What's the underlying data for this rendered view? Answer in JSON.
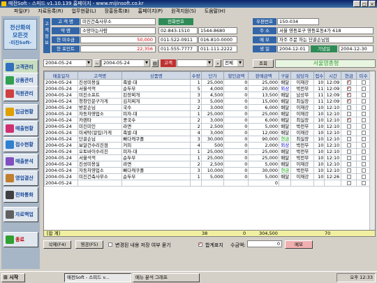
{
  "window": {
    "title": "매전Soft - 스피드 v1.10.139 홈페이지 - www.mijinsoft.co.kr"
  },
  "menu": [
    "파일(F)",
    "자료등록(R)",
    "업무현황(L)",
    "장홍등록(B)",
    "홈페이지(P)",
    "원격지원(S)",
    "도움말(H)"
  ],
  "sidebar": {
    "logo_lines": [
      "전산화의",
      "모든것",
      "-미진Soft-"
    ],
    "items": [
      {
        "label": "고객관리",
        "icon": "customer-icon",
        "color": "#3070c0"
      },
      {
        "label": "상품관리",
        "icon": "product-icon",
        "color": "#30a050"
      },
      {
        "label": "직원관리",
        "icon": "staff-icon",
        "color": "#d04040"
      },
      {
        "label": "입금현황",
        "icon": "deposit-icon",
        "color": "#e0a000"
      },
      {
        "label": "매출현황",
        "icon": "sales-chart-icon",
        "color": "#d03070"
      },
      {
        "label": "접수현황",
        "icon": "receipt-icon",
        "color": "#3080d0"
      },
      {
        "label": "매출분석",
        "icon": "analysis-icon",
        "color": "#8050c0"
      },
      {
        "label": "영업결산",
        "icon": "settlement-icon",
        "color": "#c08030"
      },
      {
        "label": "전화통화",
        "icon": "phone-icon",
        "color": "#404040"
      },
      {
        "label": "자료백업",
        "icon": "backup-icon",
        "color": "#606060"
      },
      {
        "label": "종료",
        "icon": "exit-icon",
        "color": "#30a030"
      }
    ]
  },
  "customer": {
    "side_label": "고객정보",
    "labels": {
      "name": "고 객 명",
      "about": "약 명",
      "unpaid": "현 미수금",
      "points": "현 포인트",
      "phone": "전화번호",
      "postal": "우편번호",
      "address": "주 소",
      "memo": "메 모",
      "birth": "생 일",
      "anniversary": "기념일"
    },
    "name": "미진건축사무소",
    "about": "소망아는사람",
    "unpaid": "50,000",
    "points": "22,356",
    "phones": [
      "02-843-1510",
      "1544-8680",
      "011-522-0911",
      "016-810-0000",
      "011-555-7777",
      "011-111-2222"
    ],
    "postal": "150-034",
    "address": "서울 영등포구 영등포동4가 618",
    "memo": "자주 주문 하는 단골손님임",
    "birth": "2004-12-01",
    "anniversary": "2004-12-30"
  },
  "filter": {
    "date_from": "2004-05-24",
    "date_to": "2004-05-24",
    "customer_label": "고객",
    "scope": "전체",
    "query_button": "조회",
    "region": "서울영총형"
  },
  "table": {
    "columns": [
      "매출일자",
      "고객명",
      "상품명",
      "수량",
      "단가",
      "할인금액",
      "판매금액",
      "구분",
      "담당자",
      "접수",
      "시간",
      "현금",
      "미수"
    ],
    "rows": [
      [
        "2004-05-24",
        "진성미용실",
        "족발-대",
        "1",
        "25,000",
        "0",
        "25,000",
        "배달",
        "이재강",
        "10",
        "12:09",
        true
      ],
      [
        "2004-05-24",
        "서울석적",
        "순두부",
        "5",
        "4,000",
        "0",
        "20,000",
        "외상",
        "박전무",
        "11",
        "12:09",
        true
      ],
      [
        "2004-05-24",
        "미진소프트",
        "된장찌개",
        "3",
        "4,500",
        "0",
        "13,500",
        "배달",
        "남상무",
        "11",
        "12:09",
        true
      ],
      [
        "2004-05-24",
        "청창인문구가게",
        "김치찌개",
        "3",
        "5,000",
        "0",
        "15,000",
        "배달",
        "최실장",
        "11",
        "12:09",
        true
      ],
      [
        "2004-05-24",
        "방문손님",
        "국수",
        "2",
        "3,000",
        "0",
        "6,000",
        "배달",
        "이재강",
        "10",
        "12:10",
        false
      ],
      [
        "2004-05-24",
        "자동차영업소",
        "피자-대",
        "1",
        "25,000",
        "0",
        "25,000",
        "배달",
        "이재강",
        "10",
        "12:10",
        false
      ],
      [
        "2004-05-24",
        "카렌타",
        "콩국수",
        "2",
        "3,000",
        "0",
        "6,000",
        "배달",
        "최실장",
        "10",
        "12:10",
        true
      ],
      [
        "2004-05-24",
        "미진미인",
        "라면",
        "2",
        "2,500",
        "0",
        "5,000",
        "배달",
        "박전무",
        "10",
        "12:10",
        false
      ],
      [
        "2004-05-24",
        "미세탁(알입)가게",
        "족발-대",
        "4",
        "3,000",
        "0",
        "12,000",
        "배달",
        "이재강",
        "10",
        "12:10",
        false
      ],
      [
        "2004-05-24",
        "단골손님",
        "빠다캐쿠폴",
        "3",
        "30,000",
        "0",
        "90,000",
        "현금",
        "최실장",
        "10",
        "12:10",
        false
      ],
      [
        "2004-05-24",
        "보알건수리진점",
        "커피",
        "4",
        "500",
        "0",
        "2,000",
        "외상",
        "박전무",
        "10",
        "12:10",
        false
      ],
      [
        "2004-05-24",
        "오토바이수리진",
        "피자-대",
        "1",
        "25,000",
        "0",
        "25,000",
        "배달",
        "박전무",
        "10",
        "12:10",
        false
      ],
      [
        "2004-05-24",
        "서울석적",
        "순두부",
        "1",
        "25,000",
        "0",
        "25,000",
        "배달",
        "박전무",
        "10",
        "12:10",
        false
      ],
      [
        "2004-05-24",
        "진성미용실",
        "라면",
        "2",
        "2,500",
        "0",
        "5,000",
        "배달",
        "이재강",
        "10",
        "12:10",
        false
      ],
      [
        "2004-05-24",
        "자동차영업소",
        "빠다캐쿠폴",
        "3",
        "10,000",
        "0",
        "30,000",
        "현금",
        "박전무",
        "10",
        "12:10",
        false
      ],
      [
        "2004-05-24",
        "미진건축사무소",
        "순두부",
        "1",
        "5,000",
        "0",
        "5,000",
        "배달",
        "이재강",
        "10",
        "12:26",
        false
      ],
      [
        "2004-05-24",
        "",
        "",
        "",
        "",
        "",
        "0",
        "",
        "",
        "",
        "",
        false
      ]
    ]
  },
  "totals": {
    "label": "[합 계]",
    "qty": "38",
    "discount": "0",
    "sales": "304,500",
    "receipts": "70"
  },
  "bottom": {
    "delete_button": "삭제(F4)",
    "receipt_button": "영공(F5)",
    "check_label": "변경된 내용 저장 여부 묻기",
    "sum_toggle": "합계표지",
    "amount_label": "수금액:",
    "amount_value": "0",
    "memo_button": "메모"
  },
  "taskbar": {
    "start": "시작",
    "tasks": [
      "매전Soft - 스피드 v...",
      "메뉴 분석 그래프"
    ],
    "clock": "오후 12:33"
  }
}
